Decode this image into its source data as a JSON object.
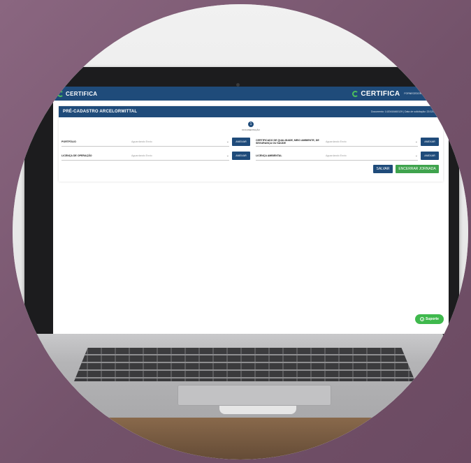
{
  "app": {
    "brand_left": "CERTIFICA",
    "brand_right": "CERTIFICA",
    "user_name": "FORNECEDOR ARCELOR",
    "accent": "#1f4b7a",
    "success": "#3fa34d"
  },
  "page": {
    "title": "PRÉ-CADASTRO ARCELORMITTAL",
    "meta": "Documento: 1420416460129 | Data de solicitação: 22/12/2021",
    "step_number": "1",
    "step_label": "DOCUMENTAÇÃO"
  },
  "documents": [
    {
      "label": "PORTFÓLIO",
      "status": "Aguardando Envio",
      "action": "ANEXAR"
    },
    {
      "label": "CERTIFICADO DE QUALIDADE, MEIO AMBIENTE, DE SEGURANÇA OU SAÚDE",
      "status": "Aguardando Envio",
      "action": "ANEXAR"
    },
    {
      "label": "LICENÇA DE OPERAÇÃO",
      "status": "Aguardando Envio",
      "action": "ANEXAR"
    },
    {
      "label": "LICENÇA AMBIENTAL",
      "status": "Aguardando Envio",
      "action": "ANEXAR"
    }
  ],
  "actions": {
    "save": "SALVAR",
    "finish": "ENCERRAR JORNADA"
  },
  "support": {
    "label": "Suporte",
    "icon": "question-icon"
  }
}
